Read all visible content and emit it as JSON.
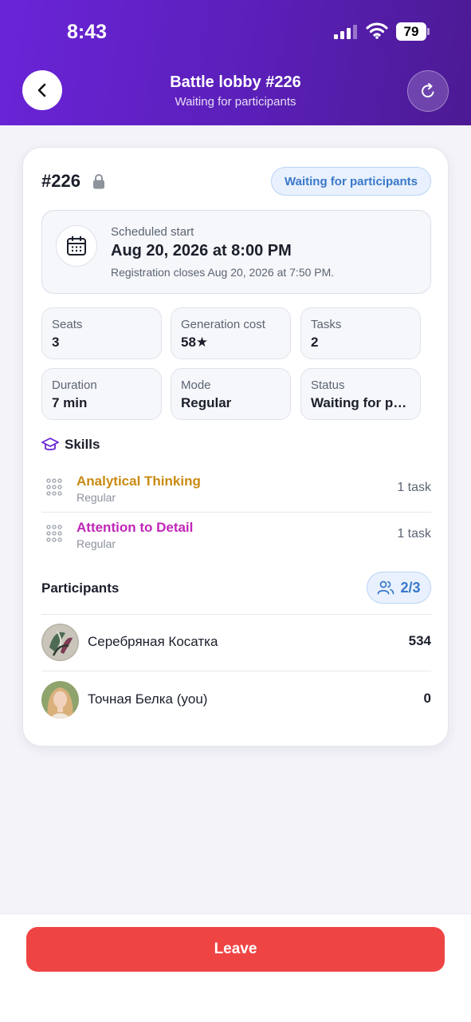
{
  "status_bar": {
    "time": "8:43",
    "battery": "79"
  },
  "header": {
    "title": "Battle lobby #226",
    "subtitle": "Waiting for participants"
  },
  "lobby": {
    "id": "#226",
    "status_pill": "Waiting for participants",
    "schedule": {
      "label": "Scheduled start",
      "value": "Aug 20, 2026 at 8:00 PM",
      "note": "Registration closes Aug 20, 2026 at 7:50 PM."
    },
    "stats": [
      {
        "label": "Seats",
        "value": "3"
      },
      {
        "label": "Generation cost",
        "value": "58★"
      },
      {
        "label": "Tasks",
        "value": "2"
      },
      {
        "label": "Duration",
        "value": "7 min"
      },
      {
        "label": "Mode",
        "value": "Regular"
      },
      {
        "label": "Status",
        "value": "Waiting for participants"
      }
    ]
  },
  "skills": {
    "title": "Skills",
    "items": [
      {
        "name": "Analytical Thinking",
        "mode": "Regular",
        "count": "1 task",
        "color": "#c98a12"
      },
      {
        "name": "Attention to Detail",
        "mode": "Regular",
        "count": "1 task",
        "color": "#c026b8"
      }
    ]
  },
  "participants": {
    "title": "Participants",
    "count": "2/3",
    "items": [
      {
        "name": "Серебряная Косатка",
        "score": "534"
      },
      {
        "name": "Точная Белка (you)",
        "score": "0"
      }
    ]
  },
  "footer": {
    "leave_label": "Leave"
  },
  "colors": {
    "header_start": "#6a24d8",
    "header_end": "#4c1a93",
    "accent_blue": "#3a78c9",
    "danger": "#ef4444"
  }
}
